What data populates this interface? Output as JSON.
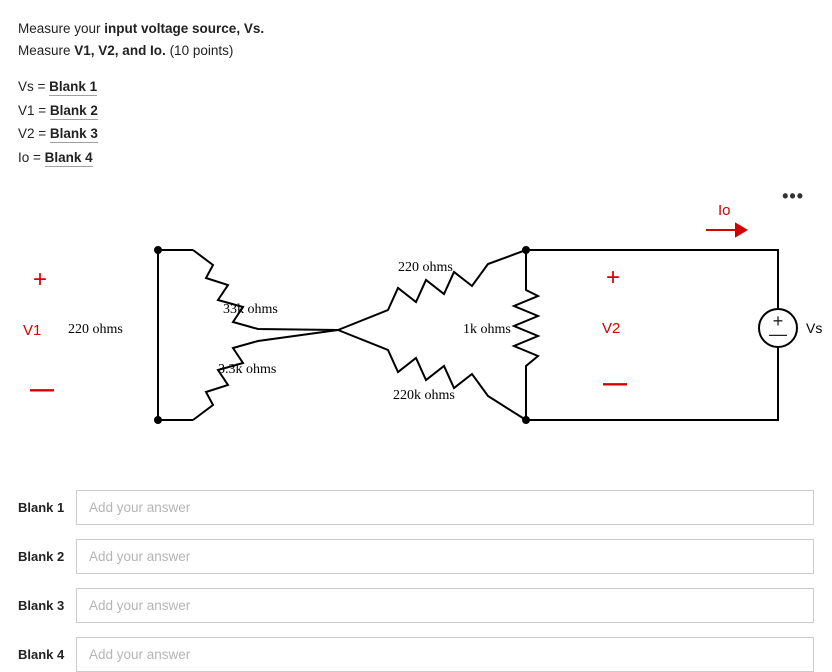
{
  "instructions": {
    "line1_pre": "Measure your ",
    "line1_bold": "input voltage source, Vs.",
    "line2_pre": "Measure ",
    "line2_bold": "V1, V2, and Io.",
    "line2_post": " (10 points)"
  },
  "equations": {
    "vs": {
      "lhs": "Vs = ",
      "ref": "Blank 1"
    },
    "v1": {
      "lhs": "V1 = ",
      "ref": "Blank 2"
    },
    "v2": {
      "lhs": "V2 = ",
      "ref": "Blank 3"
    },
    "io": {
      "lhs": "Io = ",
      "ref": "Blank 4"
    }
  },
  "diagram": {
    "io_label": "Io",
    "v1_label": "V1",
    "v2_label": "V2",
    "vs_label": "Vs",
    "plus": "+",
    "minus": "—",
    "r_left": "220 ohms",
    "r_upper": "33k ohms",
    "r_lower": "3.3k ohms",
    "r_top_right": "220 ohms",
    "r_bot_right": "220k ohms",
    "r_right": "1k ohms"
  },
  "more": "•••",
  "blanks": [
    {
      "label": "Blank 1",
      "placeholder": "Add your answer"
    },
    {
      "label": "Blank 2",
      "placeholder": "Add your answer"
    },
    {
      "label": "Blank 3",
      "placeholder": "Add your answer"
    },
    {
      "label": "Blank 4",
      "placeholder": "Add your answer"
    }
  ]
}
